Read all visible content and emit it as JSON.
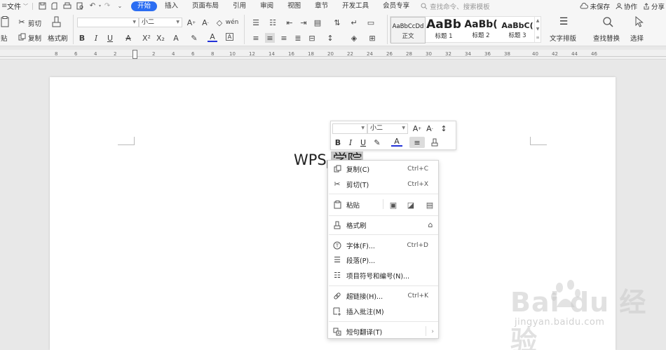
{
  "menubar": {
    "file_label": "文件",
    "tabs": [
      {
        "label": "开始",
        "active": true
      },
      {
        "label": "插入",
        "active": false
      },
      {
        "label": "页面布局",
        "active": false
      },
      {
        "label": "引用",
        "active": false
      },
      {
        "label": "审阅",
        "active": false
      },
      {
        "label": "视图",
        "active": false
      },
      {
        "label": "章节",
        "active": false
      },
      {
        "label": "开发工具",
        "active": false
      },
      {
        "label": "会员专享",
        "active": false
      }
    ],
    "search_placeholder": "查找命令、搜索模板",
    "unsaved_label": "未保存",
    "collab_label": "协作",
    "share_label": "分享"
  },
  "ribbon": {
    "paste_label": "贴",
    "cut_label": "剪切",
    "copy_label": "复制",
    "format_painter_label": "格式刷",
    "font_name": "",
    "font_size": "小二",
    "styles": [
      {
        "preview": "AaBbCcDd",
        "label": "正文",
        "selected": true
      },
      {
        "preview": "AaBb",
        "label": "标题 1",
        "selected": false
      },
      {
        "preview": "AaBb(",
        "label": "标题 2",
        "selected": false
      },
      {
        "preview": "AaBbC(",
        "label": "标题 3",
        "selected": false
      }
    ],
    "text_layout_label": "文字排版",
    "find_replace_label": "查找替换",
    "select_label": "选择"
  },
  "ruler": {
    "ticks": [
      "8",
      "6",
      "4",
      "2",
      "2",
      "4",
      "6",
      "8",
      "10",
      "12",
      "14",
      "16",
      "18",
      "20",
      "22",
      "24",
      "26",
      "28",
      "30",
      "32",
      "34",
      "36",
      "38",
      "40",
      "42",
      "44",
      "46"
    ]
  },
  "document": {
    "text_plain": "WPS ",
    "text_highlighted": "学院"
  },
  "mini_toolbar": {
    "font_name": "",
    "font_size": "小二"
  },
  "context_menu": {
    "items": [
      {
        "label": "复制(C)",
        "shortcut": "Ctrl+C",
        "icon": "copy-icon"
      },
      {
        "label": "剪切(T)",
        "shortcut": "Ctrl+X",
        "icon": "scissors-icon"
      },
      {
        "label": "粘贴",
        "shortcut": "",
        "icon": "paste-icon"
      },
      {
        "label": "格式刷",
        "shortcut": "",
        "icon": "brush-icon"
      },
      {
        "label": "字体(F)...",
        "shortcut": "Ctrl+D",
        "icon": "font-icon"
      },
      {
        "label": "段落(P)...",
        "shortcut": "",
        "icon": "paragraph-icon"
      },
      {
        "label": "项目符号和编号(N)...",
        "shortcut": "",
        "icon": "list-icon"
      },
      {
        "label": "超链接(H)...",
        "shortcut": "Ctrl+K",
        "icon": "link-icon"
      },
      {
        "label": "插入批注(M)",
        "shortcut": "",
        "icon": "comment-icon"
      },
      {
        "label": "短句翻译(T)",
        "shortcut": "",
        "icon": "translate-icon"
      }
    ],
    "submenu_arrow": "›"
  },
  "watermark": {
    "brand": "Bai du 经验",
    "url": "jingyan.baidu.com"
  }
}
